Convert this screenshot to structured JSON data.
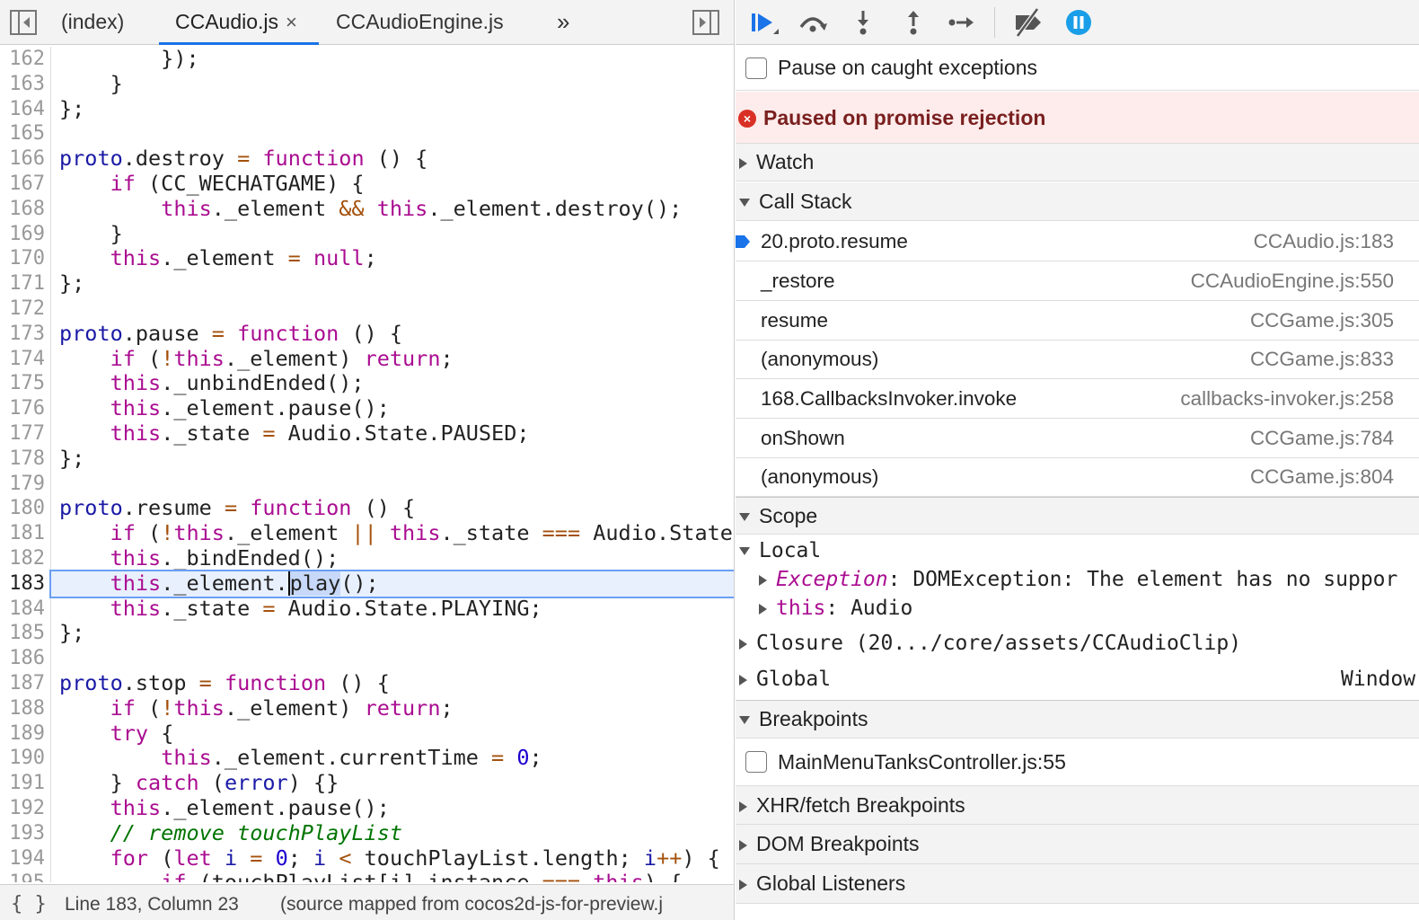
{
  "editor": {
    "tabs": [
      {
        "label": "(index)"
      },
      {
        "label": "CCAudio.js",
        "close": "×"
      },
      {
        "label": "CCAudioEngine.js"
      }
    ],
    "overflow": "»",
    "status": {
      "format_icon": "{ }",
      "position": "Line 183, Column 23",
      "source": "(source mapped from cocos2d-js-for-preview.j"
    },
    "line_numbers": [
      "162",
      "163",
      "164",
      "165",
      "166",
      "167",
      "168",
      "169",
      "170",
      "171",
      "172",
      "173",
      "174",
      "175",
      "176",
      "177",
      "178",
      "179",
      "180",
      "181",
      "182",
      "183",
      "184",
      "185",
      "186",
      "187",
      "188",
      "189",
      "190",
      "191",
      "192",
      "193",
      "194",
      "195"
    ],
    "current_line": "183"
  },
  "debugger": {
    "pause_on_caught": "Pause on caught exceptions",
    "paused_message": "Paused on promise rejection",
    "sections": {
      "watch": "Watch",
      "call_stack": "Call Stack",
      "scope": "Scope",
      "breakpoints": "Breakpoints",
      "xhr": "XHR/fetch Breakpoints",
      "dom": "DOM Breakpoints",
      "listeners": "Global Listeners"
    },
    "call_stack": [
      {
        "name": "20.proto.resume",
        "location": "CCAudio.js:183"
      },
      {
        "name": "_restore",
        "location": "CCAudioEngine.js:550"
      },
      {
        "name": "resume",
        "location": "CCGame.js:305"
      },
      {
        "name": "(anonymous)",
        "location": "CCGame.js:833"
      },
      {
        "name": "168.CallbacksInvoker.invoke",
        "location": "callbacks-invoker.js:258"
      },
      {
        "name": "onShown",
        "location": "CCGame.js:784"
      },
      {
        "name": "(anonymous)",
        "location": "CCGame.js:804"
      }
    ],
    "scope": {
      "local": "Local",
      "exception_key": "Exception",
      "exception_value": ": DOMException: The element has no suppor",
      "this_key": "this",
      "this_value": ": Audio",
      "closure": "Closure (20.../core/assets/CCAudioClip)",
      "global": "Global",
      "global_value": "Window"
    },
    "breakpoint": "MainMenuTanksController.js:55"
  },
  "colors": {
    "accent": "#1a73e8",
    "keyword": "#aa0d91",
    "operator": "#a4510c",
    "number": "#1c00cf",
    "comment": "#007400",
    "error": "#d93025",
    "paused_bg": "#fdeceb"
  },
  "icons": [
    "toggle-navigator-icon",
    "overflow-tabs-icon",
    "toggle-debugger-icon",
    "resume-icon",
    "step-over-icon",
    "step-into-icon",
    "step-out-icon",
    "step-icon",
    "deactivate-breakpoints-icon",
    "pause-on-exceptions-icon",
    "error-icon",
    "current-frame-arrow-icon"
  ]
}
